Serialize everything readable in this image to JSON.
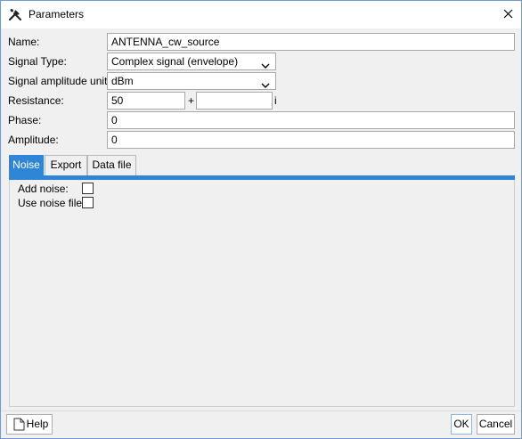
{
  "window": {
    "title": "Parameters",
    "icon": "tools-icon",
    "close_icon": "close-icon"
  },
  "form": {
    "name_label": "Name:",
    "name_value": "ANTENNA_cw_source",
    "signal_type_label": "Signal Type:",
    "signal_type_value": "Complex signal (envelope)",
    "amplitude_units_label": "Signal amplitude units:",
    "amplitude_units_value": "dBm",
    "resistance_label": "Resistance:",
    "resistance_real": "50",
    "resistance_plus": "+",
    "resistance_imag": "",
    "resistance_imag_suffix": "i",
    "phase_label": "Phase:",
    "phase_value": "0",
    "amplitude_label": "Amplitude:",
    "amplitude_value": "0"
  },
  "tabs": [
    {
      "label": "Noise",
      "active": true
    },
    {
      "label": "Export",
      "active": false
    },
    {
      "label": "Data file",
      "active": false
    }
  ],
  "noise_tab": {
    "add_noise_label": "Add noise:",
    "add_noise_checked": false,
    "use_noise_file_label": "Use noise file:",
    "use_noise_file_checked": false
  },
  "footer": {
    "help_label": "Help",
    "ok_label": "OK",
    "cancel_label": "Cancel"
  },
  "colors": {
    "accent": "#2f86d6",
    "window_border": "#6f9ccf",
    "background": "#f0f0f0"
  }
}
